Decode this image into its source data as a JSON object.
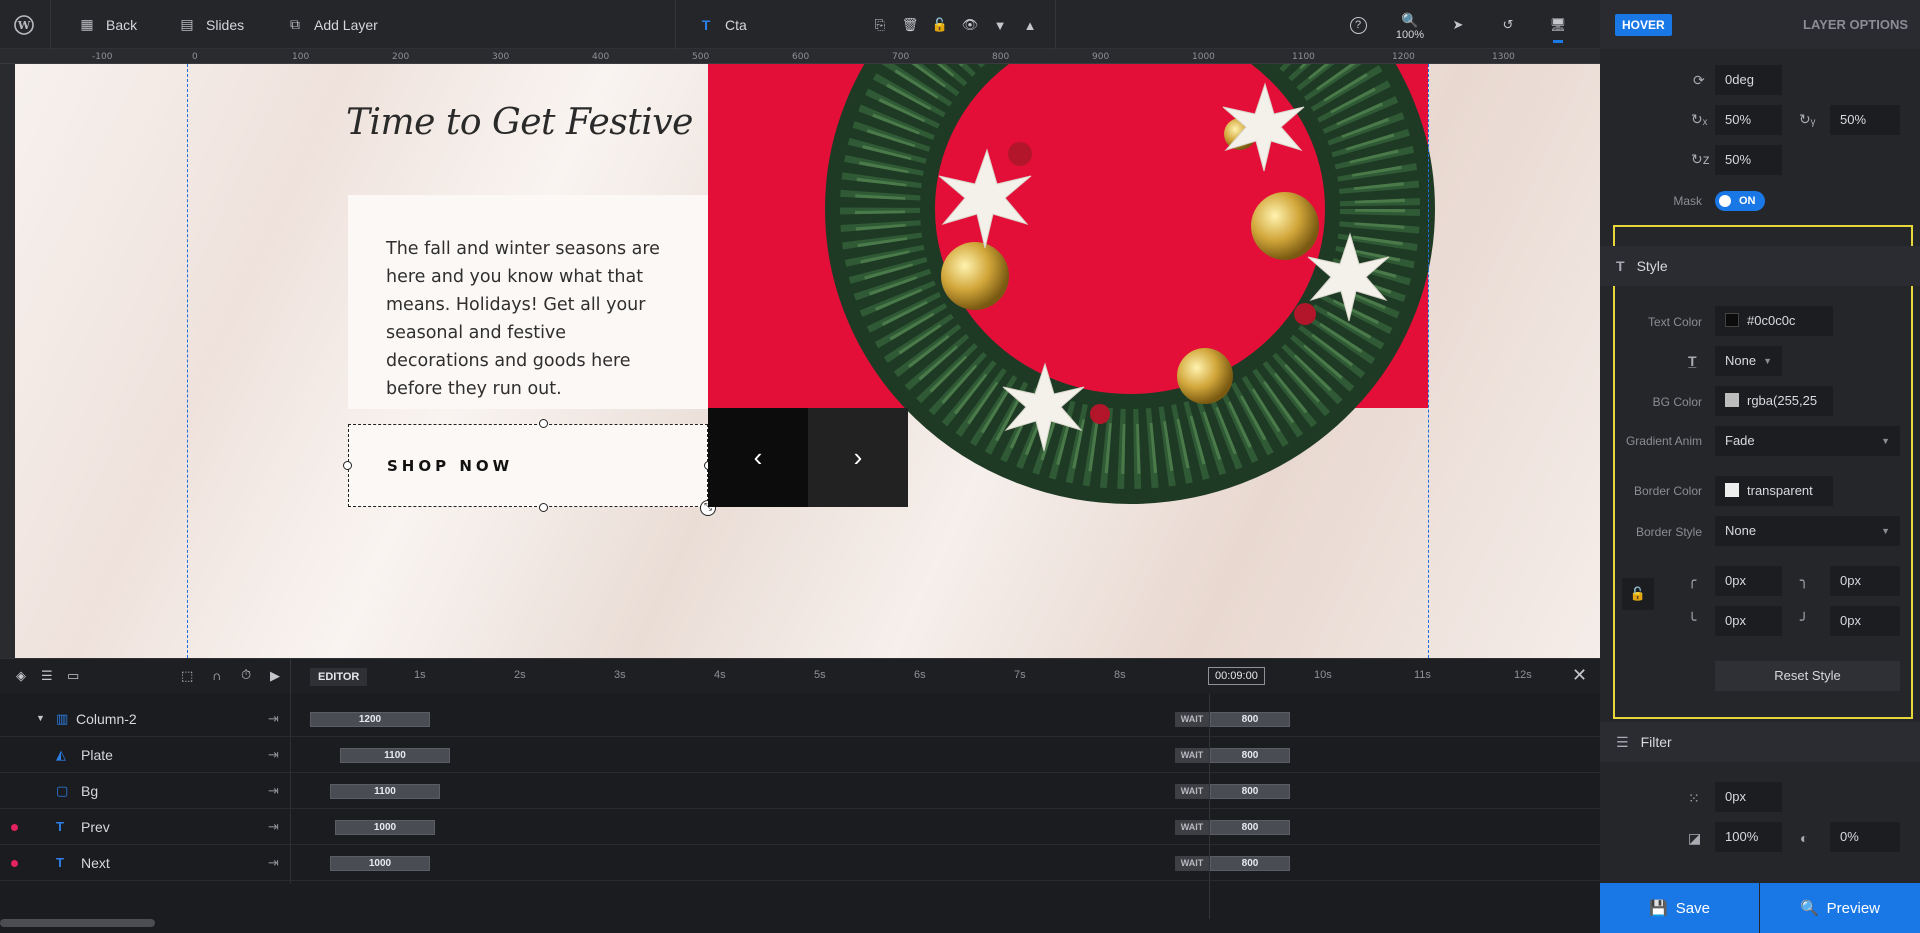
{
  "topbar": {
    "back_label": "Back",
    "slides_label": "Slides",
    "add_layer_label": "Add Layer",
    "layer_name": "Cta",
    "zoom_label": "100%"
  },
  "ruler": {
    "ticks": [
      "-100",
      "0",
      "100",
      "200",
      "300",
      "400",
      "500",
      "600",
      "700",
      "800",
      "900",
      "1000",
      "1100",
      "1200",
      "1300"
    ]
  },
  "slide": {
    "headline": "Time to Get Festive",
    "body_lines": [
      "The fall and winter seasons are",
      "here and you know what that",
      "means. Holidays! Get all your",
      "seasonal and festive",
      "decorations and goods here",
      "before they run out."
    ],
    "cta_label": "SHOP NOW",
    "prev_glyph": "‹",
    "next_glyph": "›"
  },
  "timeline": {
    "editor_label": "EDITOR",
    "time_marks": [
      "1s",
      "2s",
      "3s",
      "4s",
      "5s",
      "6s",
      "7s",
      "8s",
      "10s",
      "11s",
      "12s"
    ],
    "current_time": "00:09:00",
    "wait_label": "WAIT",
    "rows": [
      {
        "name": "Column-2",
        "icon": "column-icon",
        "bar_value": "1200",
        "wait_value": "800"
      },
      {
        "name": "Plate",
        "icon": "plate-icon",
        "bar_value": "1100",
        "wait_value": "800"
      },
      {
        "name": "Bg",
        "icon": "shape-icon",
        "bar_value": "1100",
        "wait_value": "800"
      },
      {
        "name": "Prev",
        "icon": "text-icon",
        "bar_value": "1000",
        "wait_value": "800"
      },
      {
        "name": "Next",
        "icon": "text-icon",
        "bar_value": "1000",
        "wait_value": "800"
      }
    ]
  },
  "panel": {
    "hover_label": "HOVER",
    "layer_options_label": "LAYER OPTIONS",
    "rotation_value": "0deg",
    "origin_x_value": "50%",
    "origin_y_value": "50%",
    "origin_z_value": "50%",
    "mask_label": "Mask",
    "mask_state": "ON",
    "style_section": "Style",
    "text_color_label": "Text Color",
    "text_color_value": "#0c0c0c",
    "text_transform_value": "None",
    "bg_color_label": "BG Color",
    "bg_color_value": "rgba(255,25",
    "gradient_anim_label": "Gradient Anim",
    "gradient_anim_value": "Fade",
    "border_color_label": "Border Color",
    "border_color_value": "transparent",
    "border_style_label": "Border Style",
    "border_style_value": "None",
    "radius_tl": "0px",
    "radius_tr": "0px",
    "radius_bl": "0px",
    "radius_br": "0px",
    "reset_style_label": "Reset Style",
    "filter_section": "Filter",
    "blur_value": "0px",
    "brightness_value": "100%",
    "grayscale_value": "0%",
    "save_label": "Save",
    "preview_label": "Preview"
  },
  "colors": {
    "accent": "#1a78e6",
    "slide_red": "#e40f38",
    "highlight": "#e8d73a",
    "text_color_swatch": "#0c0c0c"
  }
}
